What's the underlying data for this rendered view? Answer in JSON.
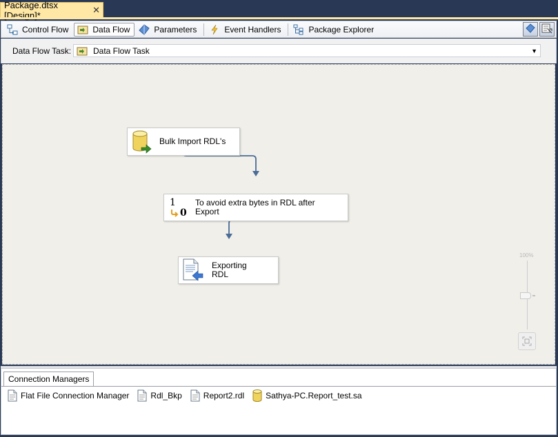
{
  "document_tab": {
    "title": "Package.dtsx [Design]*",
    "close": "✕"
  },
  "designer_tabs": [
    {
      "label": "Control Flow",
      "icon": "control-flow-icon"
    },
    {
      "label": "Data Flow",
      "icon": "data-flow-icon",
      "active": true
    },
    {
      "label": "Parameters",
      "icon": "parameters-icon"
    },
    {
      "label": "Event Handlers",
      "icon": "lightning-icon"
    },
    {
      "label": "Package Explorer",
      "icon": "tree-icon"
    }
  ],
  "task_bar": {
    "label": "Data Flow Task:",
    "selected": "Data Flow Task",
    "dropdown_arrow": "▼"
  },
  "nodes": {
    "source": {
      "label": "Bulk Import RDL's",
      "icon": "database-icon"
    },
    "transform": {
      "label_line1": "To avoid extra bytes in RDL after",
      "label_line2": "Export",
      "icon_text_1": "1",
      "icon_text_2": "0",
      "icon": "data-conversion-icon"
    },
    "destination": {
      "label_line1": "Exporting",
      "label_line2": "RDL",
      "icon": "flat-file-destination-icon"
    }
  },
  "zoom": {
    "percent_label": "100%",
    "level": 100
  },
  "connection_managers": {
    "tab_label": "Connection Managers",
    "items": [
      {
        "label": "Flat File Connection Manager",
        "icon": "file-icon"
      },
      {
        "label": "Rdl_Bkp",
        "icon": "file-icon"
      },
      {
        "label": "Report2.rdl",
        "icon": "file-icon"
      },
      {
        "label": "Sathya-PC.Report_test.sa",
        "icon": "database-icon"
      }
    ]
  },
  "colors": {
    "accent": "#ffe8a6",
    "frame": "#293955",
    "connector": "#4a6c95",
    "canvas": "#f0efea"
  }
}
